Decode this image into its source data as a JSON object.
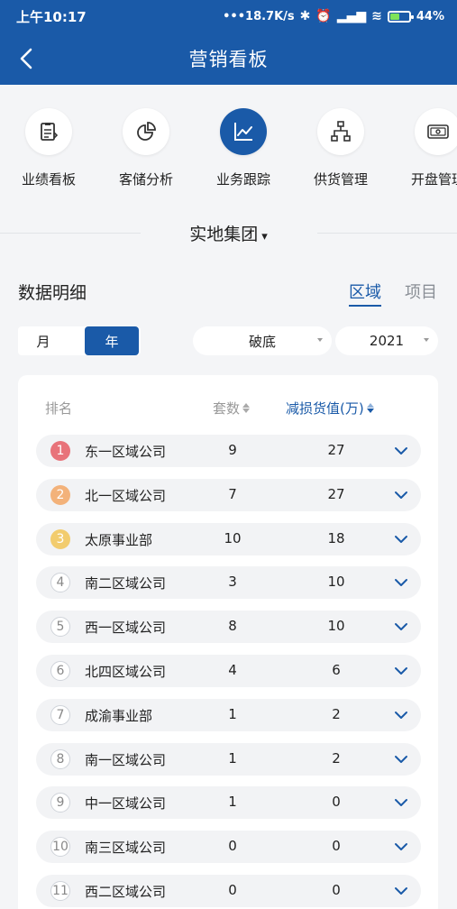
{
  "status_bar": {
    "time": "上午10:17",
    "network_speed": "•••18.7K/s",
    "battery_percent": "44%",
    "battery_level": 0.44,
    "battery_color": "#7ee35a"
  },
  "header": {
    "title": "营销看板",
    "background": "#1a5aa8"
  },
  "menu": {
    "items": [
      {
        "label": "业绩看板",
        "icon": "clipboard-icon",
        "active": false
      },
      {
        "label": "客储分析",
        "icon": "pie-chart-icon",
        "active": false
      },
      {
        "label": "业务跟踪",
        "icon": "line-chart-icon",
        "active": true
      },
      {
        "label": "供货管理",
        "icon": "hierarchy-icon",
        "active": false
      },
      {
        "label": "开盘管理",
        "icon": "cash-icon",
        "active": false
      }
    ]
  },
  "company_selector": {
    "name": "实地集团",
    "caret": "▾"
  },
  "section": {
    "title": "数据明细"
  },
  "view_tabs": [
    {
      "label": "区域",
      "active": true
    },
    {
      "label": "项目",
      "active": false
    }
  ],
  "period_toggle": [
    {
      "label": "月",
      "active": false
    },
    {
      "label": "年",
      "active": true
    }
  ],
  "filters": {
    "type_value": "破底",
    "year_value": "2021"
  },
  "table": {
    "headers": {
      "rank": "排名",
      "count": "套数",
      "value": "减损货值(万)"
    },
    "rank_colors": [
      "#e8737a",
      "#f3b27a",
      "#f2cc6e"
    ],
    "rows": [
      {
        "rank": "1",
        "name": "东一区域公司",
        "count": "9",
        "value": "27"
      },
      {
        "rank": "2",
        "name": "北一区域公司",
        "count": "7",
        "value": "27"
      },
      {
        "rank": "3",
        "name": "太原事业部",
        "count": "10",
        "value": "18"
      },
      {
        "rank": "4",
        "name": "南二区域公司",
        "count": "3",
        "value": "10"
      },
      {
        "rank": "5",
        "name": "西一区域公司",
        "count": "8",
        "value": "10"
      },
      {
        "rank": "6",
        "name": "北四区域公司",
        "count": "4",
        "value": "6"
      },
      {
        "rank": "7",
        "name": "成渝事业部",
        "count": "1",
        "value": "2"
      },
      {
        "rank": "8",
        "name": "南一区域公司",
        "count": "1",
        "value": "2"
      },
      {
        "rank": "9",
        "name": "中一区域公司",
        "count": "1",
        "value": "0"
      },
      {
        "rank": "10",
        "name": "南三区域公司",
        "count": "0",
        "value": "0"
      },
      {
        "rank": "11",
        "name": "西二区域公司",
        "count": "0",
        "value": "0"
      }
    ]
  }
}
